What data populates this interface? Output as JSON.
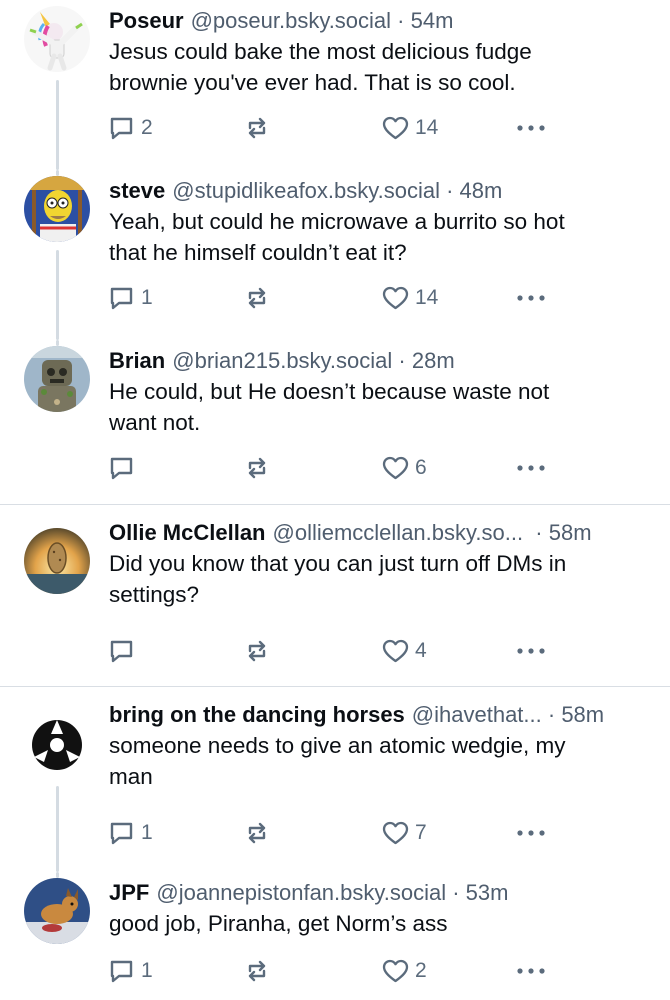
{
  "posts": [
    {
      "name": "Poseur",
      "handle": "@poseur.bsky.social",
      "time": " · 54m",
      "lines": [
        "Jesus could bake the most delicious fudge",
        "brownie you've ever had. That is so cool."
      ],
      "replies": "2",
      "reposts": "",
      "likes": "14",
      "avatar_icon": "unicorn-dab-icon"
    },
    {
      "name": "steve",
      "handle": "@stupidlikeafox.bsky.social",
      "time": " · 48m",
      "lines": [
        "Yeah, but could he microwave a burrito so hot",
        "that he himself couldn’t eat it?"
      ],
      "replies": "1",
      "reposts": "",
      "likes": "14",
      "avatar_icon": "cartoon-character-icon"
    },
    {
      "name": "Brian",
      "handle": "@brian215.bsky.social",
      "time": " · 28m",
      "lines": [
        "He could, but He doesn’t because waste not",
        "want not."
      ],
      "replies": "",
      "reposts": "",
      "likes": "6",
      "avatar_icon": "stone-idol-icon"
    },
    {
      "name": "Ollie McClellan",
      "handle": "@olliemcclellan.bsky.so...",
      "time": "  · 58m",
      "lines": [
        "Did you know that you can just turn off DMs in",
        "settings?"
      ],
      "replies": "",
      "reposts": "",
      "likes": "4",
      "avatar_icon": "potato-sunset-icon"
    },
    {
      "name": "bring on the dancing horses",
      "handle": "@ihavethat...",
      "time": " · 58m",
      "lines": [
        "someone needs to give an atomic wedgie, my",
        "man"
      ],
      "replies": "1",
      "reposts": "",
      "likes": "7",
      "avatar_icon": "record-adapter-icon"
    },
    {
      "name": "JPF",
      "handle": "@joannepistonfan.bsky.social",
      "time": " · 53m",
      "lines": [
        "good job, Piranha, get Norm’s ass"
      ],
      "replies": "1",
      "reposts": "",
      "likes": "2",
      "avatar_icon": "dog-sticker-icon"
    }
  ],
  "icons": {
    "reply": "speech-bubble-icon",
    "repost": "repost-arrows-icon",
    "like": "heart-icon",
    "more": "ellipsis-icon"
  },
  "colors": {
    "text": "#0b0f14",
    "muted": "#4f5d6e",
    "icon": "#5b6b7c",
    "thread_line": "#d4dbe2",
    "divider": "#d9dee4"
  }
}
